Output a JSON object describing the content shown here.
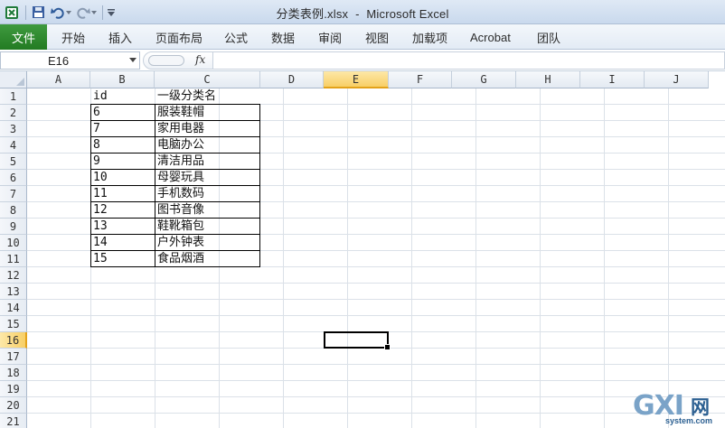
{
  "window": {
    "file_name": "分类表例.xlsx",
    "separator": "-",
    "app_name": "Microsoft Excel"
  },
  "qat": {
    "icons": [
      "excel-icon",
      "save-icon",
      "undo-icon",
      "redo-icon",
      "customize-icon"
    ]
  },
  "ribbon": {
    "file_tab": "文件",
    "tabs": [
      "开始",
      "插入",
      "页面布局",
      "公式",
      "数据",
      "审阅",
      "视图",
      "加载项",
      "Acrobat",
      "团队"
    ]
  },
  "formula_bar": {
    "name_box": "E16",
    "fx_label": "fx",
    "formula": ""
  },
  "sheet": {
    "columns": [
      "A",
      "B",
      "C",
      "D",
      "E",
      "F",
      "G",
      "H",
      "I",
      "J"
    ],
    "rows": [
      "1",
      "2",
      "3",
      "4",
      "5",
      "6",
      "7",
      "8",
      "9",
      "10",
      "11",
      "12",
      "13",
      "14",
      "15",
      "16",
      "17",
      "18",
      "19",
      "20",
      "21"
    ],
    "selected_column": "E",
    "selected_row": "16",
    "header": {
      "b": "id",
      "c": "一级分类名"
    },
    "data": [
      {
        "b": "6",
        "c": "服装鞋帽"
      },
      {
        "b": "7",
        "c": "家用电器"
      },
      {
        "b": "8",
        "c": "电脑办公"
      },
      {
        "b": "9",
        "c": "清洁用品"
      },
      {
        "b": "10",
        "c": "母婴玩具"
      },
      {
        "b": "11",
        "c": "手机数码"
      },
      {
        "b": "12",
        "c": "图书音像"
      },
      {
        "b": "13",
        "c": "鞋靴箱包"
      },
      {
        "b": "14",
        "c": "户外钟表"
      },
      {
        "b": "15",
        "c": "食品烟酒"
      }
    ]
  },
  "watermark": {
    "logo": "GXI",
    "cn": "网",
    "site": "system.com"
  },
  "colors": {
    "file_tab": "#2f8b2f",
    "selected_header": "#f8cf66",
    "grid_line": "#dbe1e8"
  }
}
